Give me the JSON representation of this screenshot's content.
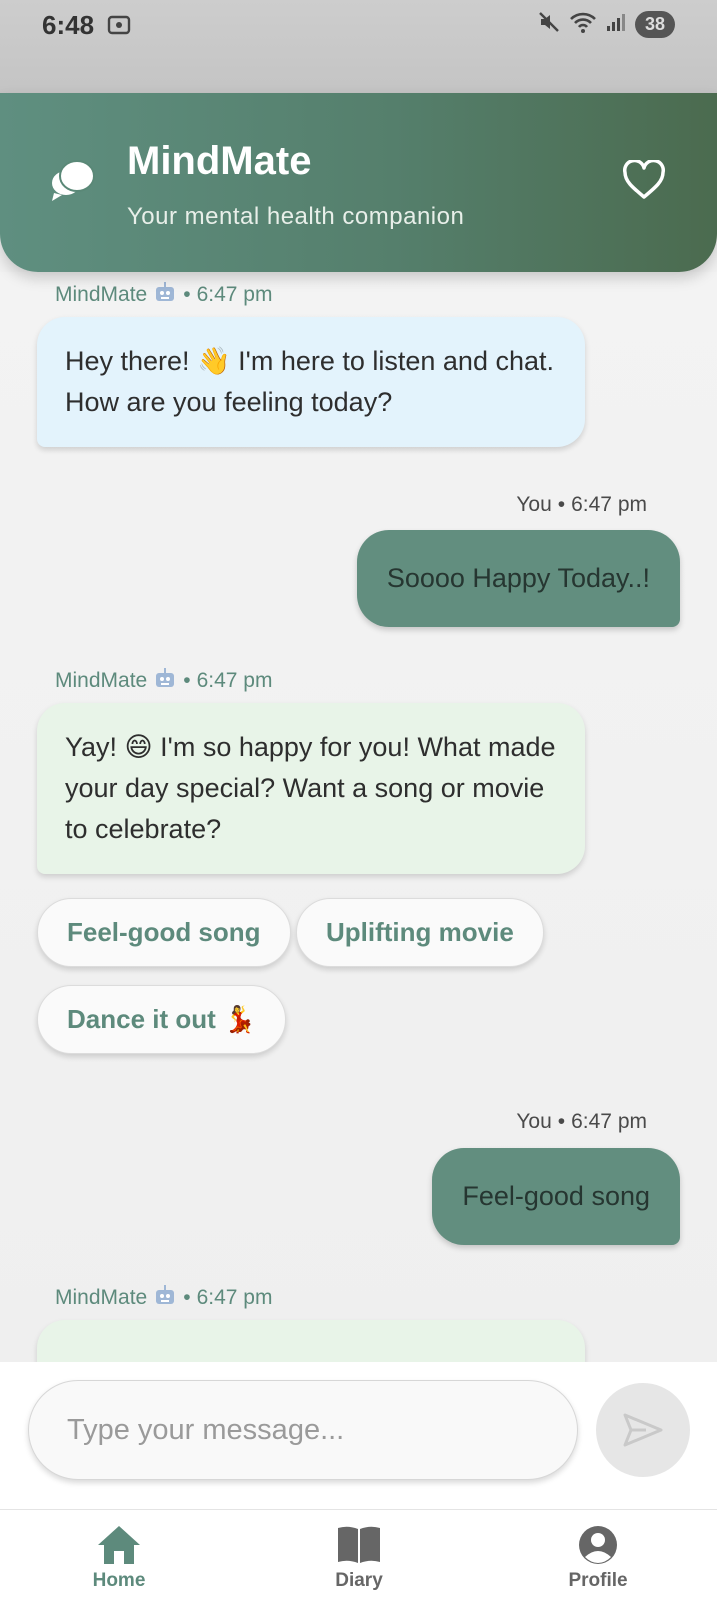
{
  "status_bar": {
    "time": "6:48",
    "battery": "38"
  },
  "header": {
    "title": "MindMate",
    "subtitle": "Your mental health companion"
  },
  "messages": [
    {
      "sender": "MindMate",
      "time": "6:47 pm",
      "text": "Hey there! 👋 I'm here to listen and chat. How are you feeling today?"
    },
    {
      "sender": "You",
      "time": "6:47 pm",
      "text": "Soooo Happy Today..!"
    },
    {
      "sender": "MindMate",
      "time": "6:47 pm",
      "text": "Yay! 😄 I'm so happy for you! What made your day special? Want a song or movie to celebrate?"
    },
    {
      "sender": "You",
      "time": "6:47 pm",
      "text": "Feel-good song"
    },
    {
      "sender": "MindMate",
      "time": "6:47 pm"
    }
  ],
  "meta_separator": "•",
  "quick_replies": [
    "Feel-good song",
    "Uplifting movie",
    "Dance it out"
  ],
  "dance_emoji": "💃",
  "input": {
    "placeholder": "Type your message..."
  },
  "nav": [
    {
      "label": "Home",
      "icon": "home-icon",
      "active": true
    },
    {
      "label": "Diary",
      "icon": "book-icon"
    },
    {
      "label": "Profile",
      "icon": "user-circle-icon"
    }
  ],
  "colors": {
    "primary": "#5d8a7c",
    "header_start": "#5f8f80",
    "header_end": "#4b6b4f",
    "bot_bubble_1": "#e3f3fc",
    "bot_bubble_2": "#e8f4e8",
    "user_bubble": "#628e7f"
  }
}
